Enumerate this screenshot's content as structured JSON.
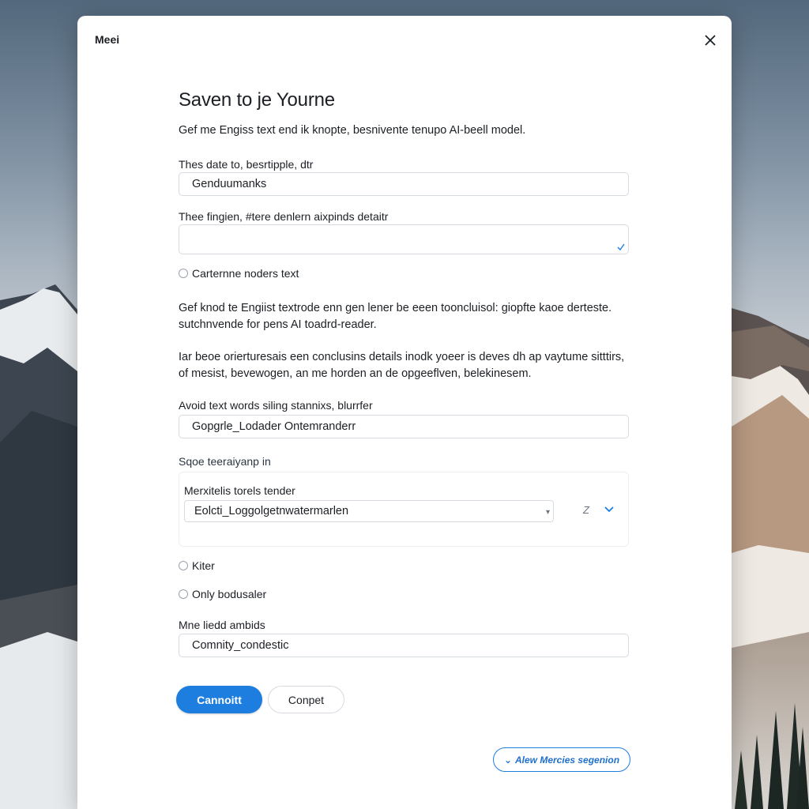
{
  "dialog": {
    "title": "Meei",
    "close_icon": "close-icon"
  },
  "main": {
    "heading": "Saven to je Yourne",
    "lead": "Gef me Engiss text end ik knopte, besnivente tenupo AI-beell model.",
    "field1": {
      "label": "Thes date to, besrtipple, dtr",
      "value": "Genduumanks"
    },
    "field2": {
      "label": "Thee fingien,  #tere denlern aixpinds detaitr",
      "value": ""
    },
    "radio1_label": "Carternne noders text",
    "para1": {
      "line1": "Gef knod te Engiist textrode enn gen lener be eeen tooncluisol: giopfte kaoe derteste.",
      "line2": "sutchnvende for pens AI toadrd-reader."
    },
    "para2": {
      "line1": "Iar beoe orierturesais een conclusins details inodk yoeer is deves dh ap vaytume sitttirs,",
      "line2": "of mesist, bevewogen, an me horden an de opgeeflven, belekinesem."
    },
    "field3": {
      "label": "Avoid text words siling stannixs, blurrfer",
      "value": "Gopgrle_Lodader Ontemranderr"
    },
    "section_label": "Sqoe teeraiyanp in",
    "group": {
      "label": "Merxitelis torels tender",
      "value": "Eolcti_Loggolgetnwatermarlen",
      "aux_glyph": "Z",
      "check_icon": "check-icon"
    },
    "radio2_label": "Kiter",
    "radio3_label": "Only bodusaler",
    "field4": {
      "label": "Mne liedd ambids",
      "value": "Comnity_condestic"
    },
    "primary_button": "Cannoitt",
    "secondary_button": "Conpet",
    "outline_button": "Alew Mercies segenion",
    "outline_button_icon": "chevron-down-icon"
  },
  "colors": {
    "accent": "#1e7ee0",
    "text": "#1b1f24",
    "border": "#d6dbe1"
  }
}
